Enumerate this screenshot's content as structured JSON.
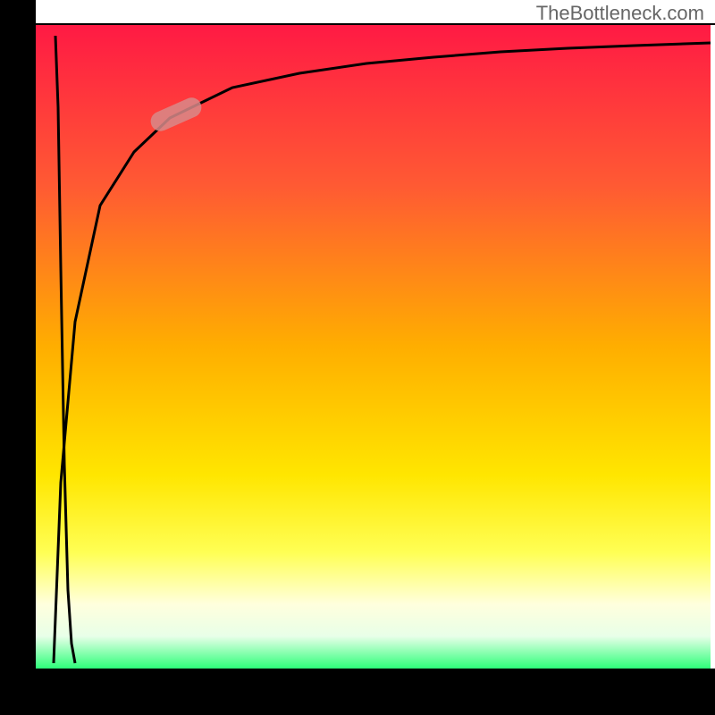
{
  "watermark": "TheBottleneck.com",
  "chart_data": {
    "type": "line",
    "title": "",
    "xlabel": "",
    "ylabel": "",
    "xlim": [
      0,
      100
    ],
    "ylim": [
      0,
      100
    ],
    "background_gradient": {
      "type": "vertical",
      "stops": [
        {
          "offset": 0,
          "color": "#ff1a44"
        },
        {
          "offset": 0.25,
          "color": "#ff5a33"
        },
        {
          "offset": 0.5,
          "color": "#ffae00"
        },
        {
          "offset": 0.7,
          "color": "#ffe600"
        },
        {
          "offset": 0.82,
          "color": "#ffff55"
        },
        {
          "offset": 0.9,
          "color": "#ffffdd"
        },
        {
          "offset": 0.95,
          "color": "#e8ffe8"
        },
        {
          "offset": 1.0,
          "color": "#2dff79"
        }
      ]
    },
    "curve1": {
      "description": "sharp vertical spike near x≈0 descending from top to bottom",
      "x": [
        3,
        3.5,
        4,
        4.5,
        5,
        5.5,
        6
      ],
      "y": [
        98,
        80,
        50,
        20,
        10,
        5,
        2
      ]
    },
    "curve2": {
      "description": "logarithmic-like rise from bottom-left to top-right",
      "x": [
        3,
        4,
        6,
        10,
        15,
        20,
        30,
        40,
        50,
        60,
        70,
        80,
        90,
        100
      ],
      "y": [
        2,
        30,
        55,
        72,
        80,
        85,
        90,
        92.5,
        94,
        95,
        95.8,
        96.4,
        96.8,
        97
      ]
    },
    "marker": {
      "description": "pill-shaped highlight on curve",
      "x": 21,
      "y": 86,
      "angle_deg": -24,
      "color": "#d88a8a"
    },
    "axes": {
      "ticks_visible": false,
      "grid": false
    }
  },
  "colors": {
    "curve_stroke": "#000000",
    "frame": "#000000",
    "marker_fill": "#d88a8a"
  }
}
